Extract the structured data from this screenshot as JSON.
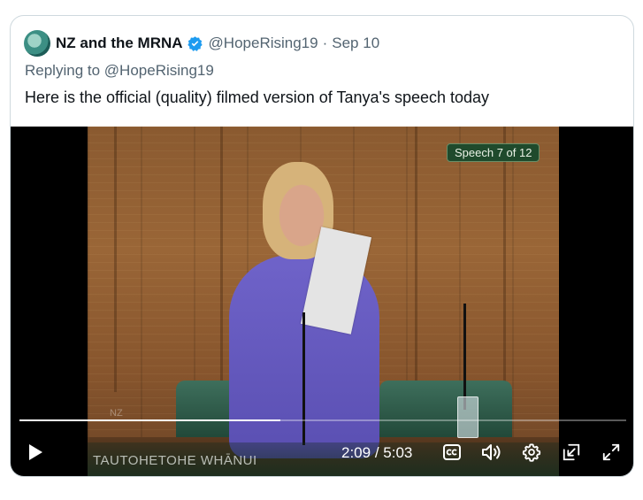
{
  "tweet": {
    "author_name": "NZ and the MRNA",
    "handle": "@HopeRising19",
    "separator": "·",
    "date": "Sep 10",
    "replying_prefix": "Replying to",
    "replying_to": "@HopeRising19",
    "text": "Here is the official (quality) filmed version of Tanya's speech today"
  },
  "video": {
    "badge": "Speech 7 of 12",
    "caption": "TAUTOHETOHE WHĀNUI",
    "crest_text": "NZ",
    "current_time": "2:09",
    "time_separator": "/",
    "duration": "5:03",
    "progress_fraction": 0.43
  },
  "colors": {
    "verified_blue": "#1d9bf0",
    "text_primary": "#0f1419",
    "text_secondary": "#536471"
  },
  "icons": {
    "play": "play-icon",
    "captions": "captions-icon",
    "volume": "volume-icon",
    "settings": "gear-icon",
    "pip": "picture-in-picture-icon",
    "fullscreen": "fullscreen-icon"
  }
}
